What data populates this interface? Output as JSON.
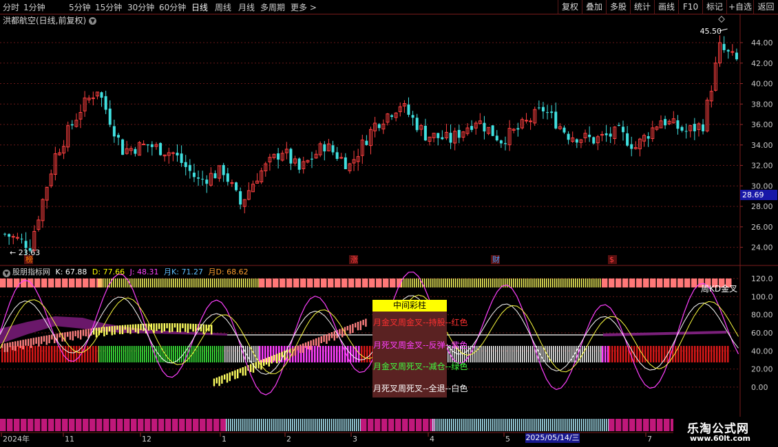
{
  "toolbar": {
    "left_tabs": [
      "分时",
      "1分钟",
      "5分钟",
      "15分钟",
      "30分钟",
      "60分钟",
      "日线",
      "周线",
      "月线",
      "多周期",
      "更多 >"
    ],
    "active_tab": "日线",
    "right_buttons": [
      "复权",
      "叠加",
      "多股",
      "统计",
      "画线",
      "F10",
      "标记",
      "+自选",
      "返回"
    ]
  },
  "stock": {
    "title": "洪都航空(日线,前复权)"
  },
  "price_axis": {
    "ticks": [
      "44.00",
      "42.00",
      "40.00",
      "38.00",
      "36.00",
      "34.00",
      "32.00",
      "30.00",
      "28.00",
      "26.00",
      "24.00"
    ],
    "current_price": "28.69"
  },
  "annotations": {
    "high_label": "45.50",
    "low_label": "23.63",
    "markers": [
      "榜",
      "涨",
      "财",
      "$"
    ]
  },
  "indicator": {
    "name": "股朋指标网",
    "values": [
      {
        "label": "K: 67.88",
        "color": "#ffffff"
      },
      {
        "label": "D: 77.66",
        "color": "#ffff00"
      },
      {
        "label": "J: 48.31",
        "color": "#ff44ff"
      },
      {
        "label": "月K: 71.27",
        "color": "#5fbfff"
      },
      {
        "label": "月D: 68.62",
        "color": "#ff9f2f"
      }
    ],
    "axis_ticks": [
      "120.0",
      "100.0",
      "80.00",
      "60.00",
      "40.00",
      "20.00",
      "0.00"
    ],
    "kd_label": "周KD金叉"
  },
  "legend": {
    "header": "中间彩柱",
    "items": [
      {
        "text": "月金叉周金叉--持股--红色",
        "color": "#ff3030"
      },
      {
        "text": "月死叉周金叉--反弹--紫色",
        "color": "#ff40ff"
      },
      {
        "text": "月金叉周死叉--减仓--绿色",
        "color": "#40ff40"
      },
      {
        "text": "月死叉周死叉--全退--白色",
        "color": "#ffffff"
      }
    ]
  },
  "date_axis": {
    "labels": [
      {
        "text": "2024年"
      },
      {
        "text": "11"
      },
      {
        "text": "12"
      },
      {
        "text": "1"
      },
      {
        "text": "2"
      },
      {
        "text": "3"
      },
      {
        "text": "4"
      },
      {
        "text": "5"
      },
      {
        "text": "7"
      }
    ],
    "highlight": "2025/05/14/三"
  },
  "watermark": {
    "line1": "乐淘公式网",
    "line2": "www.60lt.com"
  },
  "colors": {
    "up": "#ff4040",
    "down": "#40e0e0",
    "bg": "#000000",
    "grid": "#7a1c1c"
  }
}
